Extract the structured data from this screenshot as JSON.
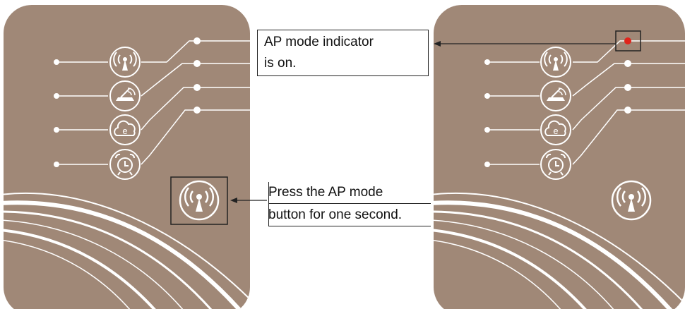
{
  "colors": {
    "panel": "#a08877",
    "line": "#ffffff",
    "indicator_on": "#e0241b"
  },
  "icons": [
    "ap-mode-icon",
    "router-icon",
    "cloud-e-icon",
    "alarm-clock-icon",
    "ap-mode-button-icon"
  ],
  "callouts": {
    "indicator": {
      "line1": "AP mode indicator",
      "line2": "is on."
    },
    "button": {
      "line1": "Press the AP mode",
      "line2": "button for one second."
    }
  }
}
